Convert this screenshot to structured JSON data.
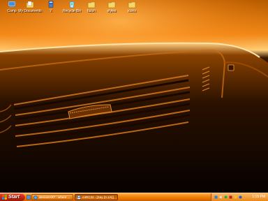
{
  "desktop": {
    "icons": [
      {
        "label": "Comp",
        "icon": "computer-icon"
      },
      {
        "label": "My Documents",
        "icon": "documents-icon"
      },
      {
        "label": "\\\\",
        "icon": "network-icon"
      },
      {
        "label": "Recycle Bin",
        "icon": "recycle-bin-icon"
      },
      {
        "label": "fuzzn",
        "icon": "folder-icon"
      },
      {
        "label": "styles",
        "icon": "folder-icon"
      },
      {
        "label": "icons",
        "icon": "folder-icon"
      }
    ]
  },
  "taskbar": {
    "start_label": "Start",
    "tasks": [
      {
        "label": "deviantART : where ...",
        "icon": "browser-icon",
        "active": false
      },
      {
        "label": "mIRC32 - [Say (0.1/s)]",
        "icon": "mirc-icon",
        "active": true
      }
    ],
    "tray_icons": [
      "network-tray-icon",
      "volume-icon",
      "messenger-icon",
      "antivirus-icon",
      "security-icon",
      "update-icon"
    ],
    "clock": "1:15 PM"
  },
  "colors": {
    "taskbar_orange": "#e47400",
    "start_red": "#c8240f",
    "wallpaper_glow": "#ff8a1a"
  }
}
